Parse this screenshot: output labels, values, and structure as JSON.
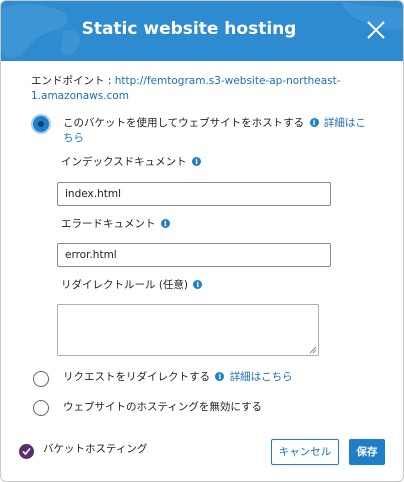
{
  "dialog": {
    "title": "Static website hosting",
    "close_icon": "close-icon",
    "header_color": "#2e8bcf"
  },
  "endpoint": {
    "label": "エンドポイント :",
    "url": "http://femtogram.s3-website-ap-northeast-1.amazonaws.com"
  },
  "options": {
    "host": {
      "label": "このバケットを使用してウェブサイトをホストする",
      "details_link": "詳細はこちら",
      "selected": true
    },
    "redirect": {
      "label": "リクエストをリダイレクトする",
      "details_link": "詳細はこちら",
      "selected": false
    },
    "disable": {
      "label": "ウェブサイトのホスティングを無効にする",
      "selected": false
    }
  },
  "fields": {
    "index_doc": {
      "label": "インデックスドキュメント",
      "value": "index.html"
    },
    "error_doc": {
      "label": "エラードキュメント",
      "value": "error.html"
    },
    "redirect_rules": {
      "label": "リダイレクトルール (任意)",
      "value": ""
    }
  },
  "footer": {
    "status_label": "バケットホスティング",
    "cancel_label": "キャンセル",
    "save_label": "保存"
  },
  "colors": {
    "accent": "#1f7ec8",
    "check": "#5a2d6e"
  }
}
